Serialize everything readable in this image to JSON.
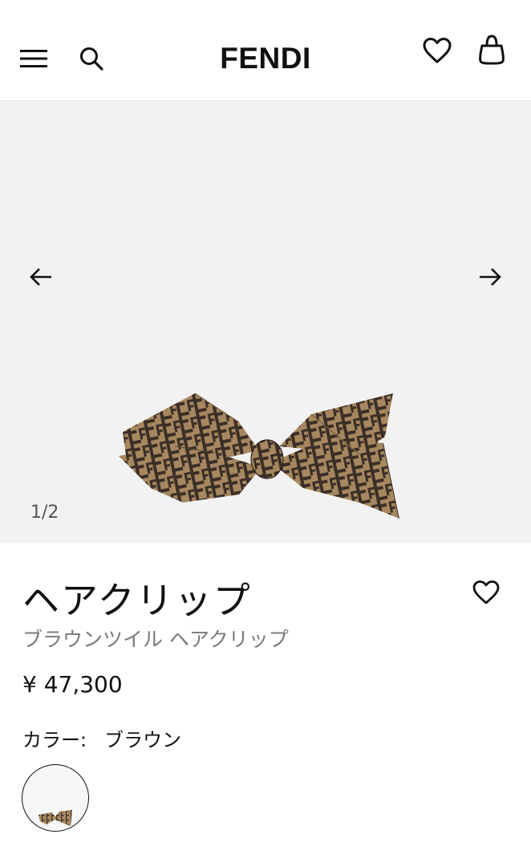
{
  "header": {
    "brand": "FENDI",
    "menu_icon": "hamburger-menu-icon",
    "search_icon": "search-icon",
    "wishlist_icon": "heart-icon",
    "bag_icon": "shopping-bag-icon"
  },
  "gallery": {
    "counter": "1/2",
    "prev_icon": "arrow-left-icon",
    "next_icon": "arrow-right-icon"
  },
  "product": {
    "title": "ヘアクリップ",
    "subtitle": "ブラウンツイル ヘアクリップ",
    "price": "¥ 47,300",
    "color_label": "カラー:",
    "color_value": "ブラウン"
  },
  "colors": {
    "bow_light": "#a7875f",
    "bow_dark": "#3b2f27",
    "gallery_bg": "#f2f2f2"
  }
}
